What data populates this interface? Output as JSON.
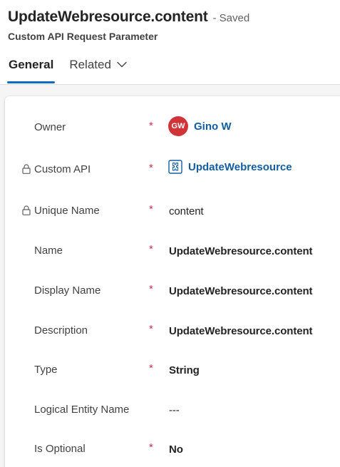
{
  "header": {
    "title": "UpdateWebresource.content",
    "save_status": "- Saved",
    "entity_type": "Custom API Request Parameter"
  },
  "tabs": {
    "general": "General",
    "related": "Related"
  },
  "colors": {
    "accent": "#0f6cbd",
    "link": "#115ea3",
    "required": "#c4314b",
    "avatar": "#d13438"
  },
  "form": {
    "owner": {
      "label": "Owner",
      "required": "*",
      "avatar_initials": "GW",
      "value": "Gino W"
    },
    "custom_api": {
      "label": "Custom API",
      "required": "*",
      "value": "UpdateWebresource",
      "icon": "custom-api-icon",
      "locked": true
    },
    "unique_name": {
      "label": "Unique Name",
      "required": "*",
      "value": "content",
      "locked": true
    },
    "name": {
      "label": "Name",
      "required": "*",
      "value": "UpdateWebresource.content"
    },
    "display_name": {
      "label": "Display Name",
      "required": "*",
      "value": "UpdateWebresource.content"
    },
    "description": {
      "label": "Description",
      "required": "*",
      "value": "UpdateWebresource.content"
    },
    "type": {
      "label": "Type",
      "required": "*",
      "value": "String"
    },
    "logical_entity_name": {
      "label": "Logical Entity Name",
      "value": "---"
    },
    "is_optional": {
      "label": "Is Optional",
      "required": "*",
      "value": "No"
    }
  }
}
